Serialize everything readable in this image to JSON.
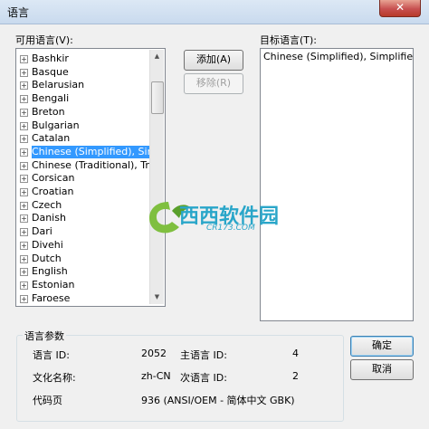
{
  "window": {
    "title": "语言",
    "close_glyph": "✕"
  },
  "available": {
    "label": "可用语言(V):",
    "items": [
      "Bashkir",
      "Basque",
      "Belarusian",
      "Bengali",
      "Breton",
      "Bulgarian",
      "Catalan",
      "Chinese (Simplified), Simplified",
      "Chinese (Traditional), Traditional",
      "Corsican",
      "Croatian",
      "Czech",
      "Danish",
      "Dari",
      "Divehi",
      "Dutch",
      "English",
      "Estonian",
      "Faroese"
    ],
    "selected_index": 7,
    "expand_glyph": "+"
  },
  "buttons": {
    "add": "添加(A)",
    "remove": "移除(R)",
    "ok": "确定",
    "cancel": "取消"
  },
  "target": {
    "label": "目标语言(T):",
    "items": [
      "Chinese (Simplified), Simplified - People's Republic of China"
    ]
  },
  "params": {
    "title": "语言参数",
    "lang_id_label": "语言 ID:",
    "lang_id": "2052",
    "primary_id_label": "主语言 ID:",
    "primary_id": "4",
    "culture_label": "文化名称:",
    "culture": "zh-CN",
    "sub_id_label": "次语言 ID:",
    "sub_id": "2",
    "codepage_label": "代码页",
    "codepage": "936 (ANSI/OEM - 简体中文 GBK)"
  },
  "watermark": {
    "text": "西西软件园",
    "sub": "CR173.COM"
  },
  "colors": {
    "selection": "#3399ff",
    "watermark_green": "#7fbf3f",
    "watermark_teal": "#2aa6c9"
  }
}
